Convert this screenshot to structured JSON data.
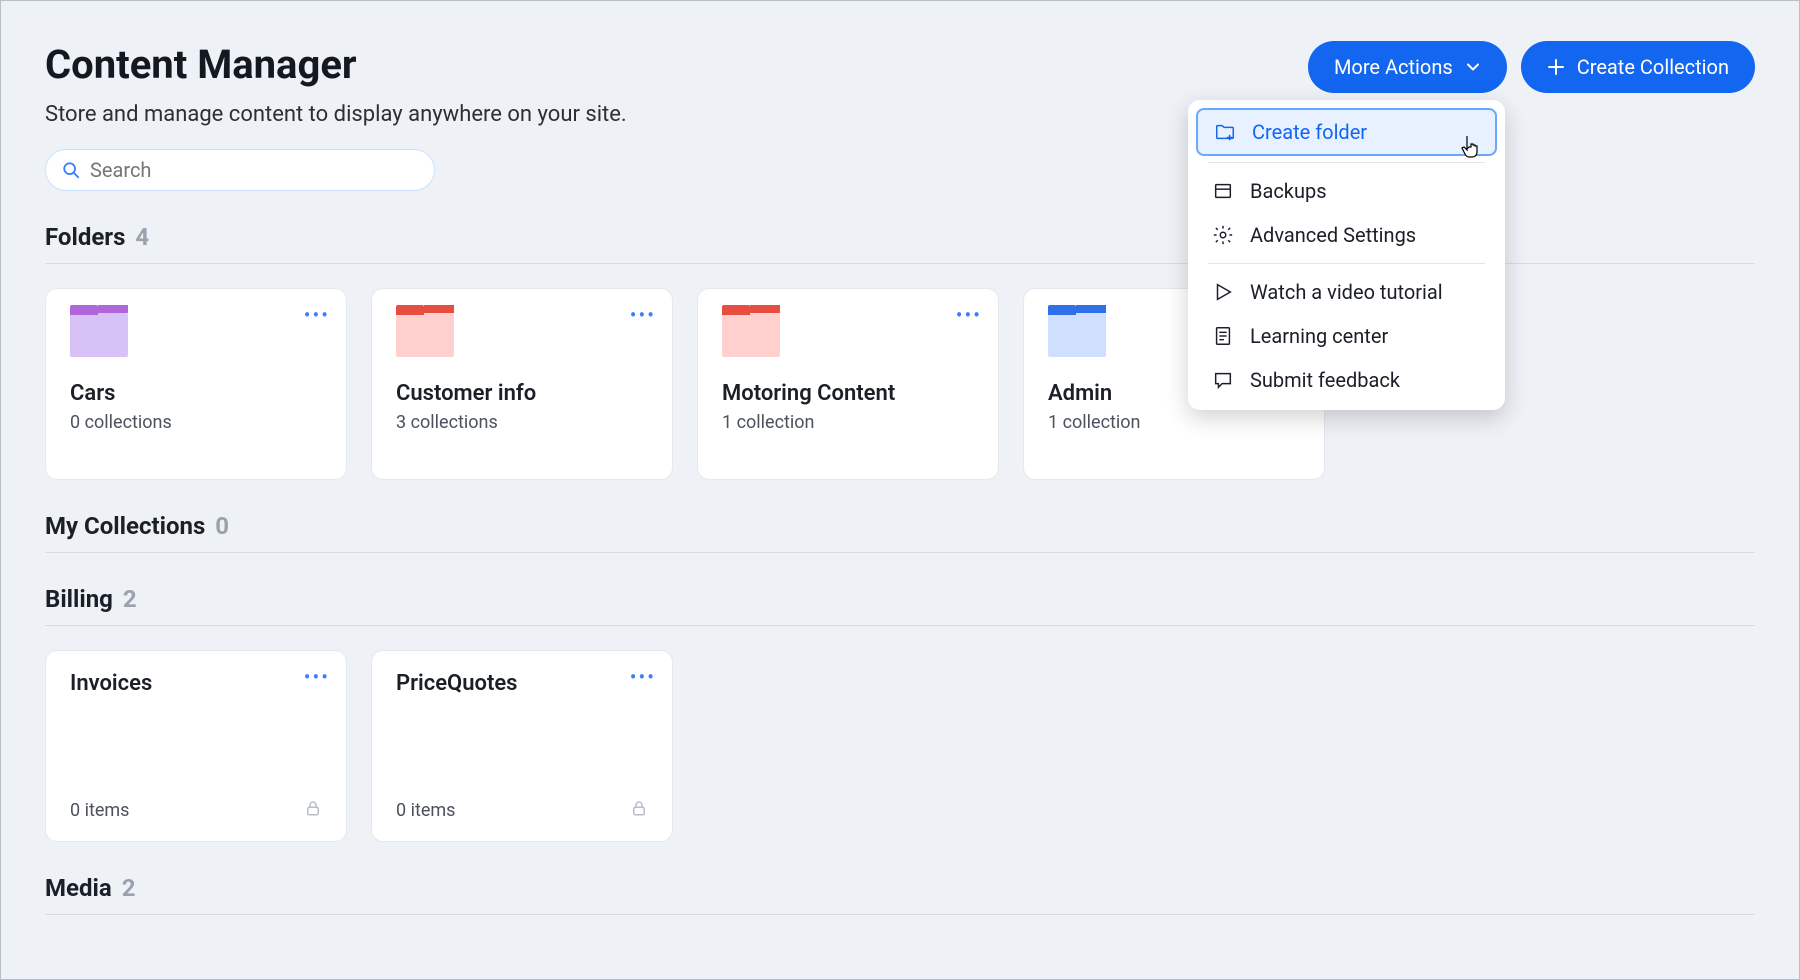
{
  "header": {
    "title": "Content Manager",
    "subtitle": "Store and manage content to display anywhere on your site.",
    "more_actions_label": "More Actions",
    "create_collection_label": "Create Collection"
  },
  "search": {
    "placeholder": "Search"
  },
  "dropdown": {
    "create_folder": "Create folder",
    "backups": "Backups",
    "advanced_settings": "Advanced Settings",
    "watch_video": "Watch a video tutorial",
    "learning_center": "Learning center",
    "submit_feedback": "Submit feedback"
  },
  "sections": {
    "folders": {
      "title": "Folders",
      "count": "4",
      "items": [
        {
          "name": "Cars",
          "sub": "0 collections",
          "body": "#d7c2f5",
          "tab": "#b066db",
          "corner": "#b066db"
        },
        {
          "name": "Customer info",
          "sub": "3 collections",
          "body": "#ffd0ce",
          "tab": "#e84e40",
          "corner": "#e84e40"
        },
        {
          "name": "Motoring Content",
          "sub": "1 collection",
          "body": "#ffd0ce",
          "tab": "#e84e40",
          "corner": "#e84e40"
        },
        {
          "name": "Admin",
          "sub": "1 collection",
          "body": "#cfe0ff",
          "tab": "#2f6fe8",
          "corner": "#2f6fe8"
        }
      ]
    },
    "my_collections": {
      "title": "My Collections",
      "count": "0"
    },
    "billing": {
      "title": "Billing",
      "count": "2",
      "items": [
        {
          "name": "Invoices",
          "sub": "0 items"
        },
        {
          "name": "PriceQuotes",
          "sub": "0 items"
        }
      ]
    },
    "media": {
      "title": "Media",
      "count": "2"
    }
  }
}
